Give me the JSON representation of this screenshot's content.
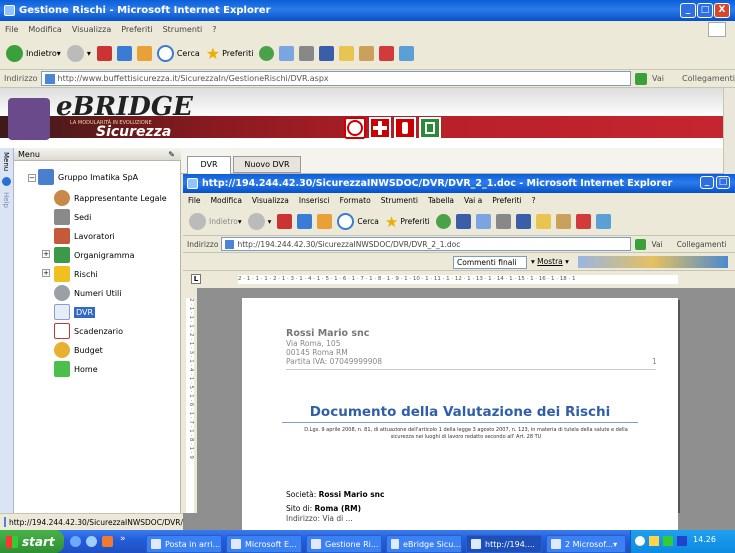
{
  "outer": {
    "title": "Gestione Rischi - Microsoft Internet Explorer",
    "menu": [
      "File",
      "Modifica",
      "Visualizza",
      "Preferiti",
      "Strumenti",
      "?"
    ],
    "toolbar": {
      "back": "Indietro",
      "search": "Cerca",
      "favorites": "Preferiti"
    },
    "address": {
      "label": "Indirizzo",
      "url": "http://www.buffettisicurezza.it/SicurezzaIn/GestioneRischi/DVR.aspx",
      "go": "Vai",
      "links": "Collegamenti"
    },
    "status": "http://194.244.42.30/SicurezzaINWSDOC/DVR/",
    "controls": {
      "min": "_",
      "max": "□",
      "close": "X"
    }
  },
  "banner": {
    "logo_main": "eBRIDGE",
    "logo_tag": "LA MODULARITÀ IN EVOLUZIONE",
    "logo_sub": "Sicurezza",
    "safety_signs": [
      "no-smoking-sign-icon",
      "first-aid-cross-icon",
      "fire-extinguisher-sign-icon",
      "emergency-exit-sign-icon"
    ],
    "colors": {
      "red_band": "#B8202A",
      "dark_band": "#3E1A1A"
    }
  },
  "sidebar": {
    "header": "Menu",
    "side_tabs": [
      "Menu",
      "Help"
    ],
    "root": "Gruppo Imatika SpA",
    "items": [
      {
        "label": "Rappresentante Legale",
        "icon": "person-icon"
      },
      {
        "label": "Sedi",
        "icon": "building-icon"
      },
      {
        "label": "Lavoratori",
        "icon": "workers-icon"
      },
      {
        "label": "Organigramma",
        "icon": "org-chart-icon"
      },
      {
        "label": "Rischi",
        "icon": "warning-icon"
      },
      {
        "label": "Numeri Utili",
        "icon": "phone-icon"
      },
      {
        "label": "DVR",
        "icon": "document-icon"
      },
      {
        "label": "Scadenzario",
        "icon": "calendar-icon"
      },
      {
        "label": "Budget",
        "icon": "coin-icon"
      },
      {
        "label": "Home",
        "icon": "home-arrow-icon"
      }
    ]
  },
  "tabs": [
    "DVR",
    "Nuovo DVR"
  ],
  "inner": {
    "title": "http://194.244.42.30/SicurezzaINWSDOC/DVR/DVR_2_1.doc - Microsoft Internet Explorer",
    "menu": [
      "File",
      "Modifica",
      "Visualizza",
      "Inserisci",
      "Formato",
      "Strumenti",
      "Tabella",
      "Vai a",
      "Preferiti",
      "?"
    ],
    "toolbar": {
      "back": "Indietro",
      "search": "Cerca",
      "favorites": "Preferiti"
    },
    "address": {
      "label": "Indirizzo",
      "url": "http://194.244.42.30/SicurezzaINWSDOC/DVR/DVR_2_1.doc",
      "go": "Vai",
      "links": "Collegamenti"
    },
    "review": {
      "mode": "Commenti finali",
      "show": "Mostra"
    },
    "ruler_text": "2 · 1 · 1 · 1 · 2 · 1 · 3 · 1 · 4 · 1 · 5 · 1 · 6 · 1 · 7 · 1 · 8 · 1 · 9 · 1 · 10 · 1 · 11 · 1 · 12 · 1 · 13 · 1 · 14 · 1 · 15 · 1 · 16 · 1 · 18 · 1",
    "vruler_text": "2 · 1 · 1 · 1 · 2 · 1 · 3 · 1 · 4 · 1 · 5 · 1 · 6 · 1 · 7 · 1 · 8 · 1 · 9",
    "ruler_tab": "L"
  },
  "document": {
    "company": "Rossi Mario snc",
    "address1": "Via Roma, 105",
    "address2": "00145 Roma RM",
    "vat": "Partita IVA: 07049999908",
    "page_no": "1",
    "heading": "Documento della Valutazione dei Rischi",
    "legal_line1": "D.Lgs. 9 aprile 2008, n. 81, di attuazione dell'articolo 1 della legge 3 agosto 2007, n. 123, in materia di tutela della salute e della",
    "legal_line2": "sicurezza nei luoghi di lavoro redatto secondo all' Art. 28 TU",
    "societa_label": "Società:",
    "societa_value": "Rossi Mario snc",
    "sito_label": "Sito di:",
    "sito_value": "Roma (RM)",
    "indirizzo_partial": "Indirizzo: Via di ..."
  },
  "taskbar": {
    "start": "start",
    "buttons": [
      "Posta in arri...",
      "Microsoft E...",
      "Gestione Ri...",
      "eBridge Sicu...",
      "http://194....",
      "2 Microsof..."
    ],
    "clock": "14.26",
    "color": "#245EDC"
  }
}
